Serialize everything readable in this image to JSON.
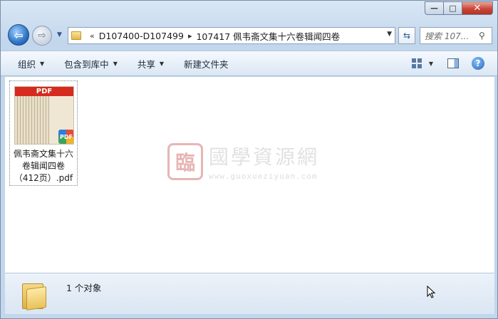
{
  "window": {
    "caption": {
      "minimize": "—",
      "maximize": "□",
      "close": "✕"
    }
  },
  "nav": {
    "back_icon": "back-arrow-icon",
    "forward_icon": "forward-arrow-icon",
    "breadcrumb_prefix": "«",
    "crumbs": [
      "D107400-D107499",
      "107417 佩韦斋文集十六卷辑闻四卷"
    ],
    "search_placeholder": "搜索 107..."
  },
  "toolbar": {
    "organize": "组织",
    "include_in_library": "包含到库中",
    "share": "共享",
    "new_folder": "新建文件夹"
  },
  "files": [
    {
      "name": "佩韦斋文集十六卷辑闻四卷（412页）.pdf",
      "thumb_band": "PDF",
      "badge": "PDF"
    }
  ],
  "watermark": {
    "logo": "臨",
    "title": "國學資源網",
    "url": "www.guoxueziyuan.com"
  },
  "status": {
    "count_text": "1 个对象"
  },
  "colors": {
    "accent": "#2e74c6",
    "close": "#c9463a",
    "pdf_red": "#d62a1e"
  }
}
